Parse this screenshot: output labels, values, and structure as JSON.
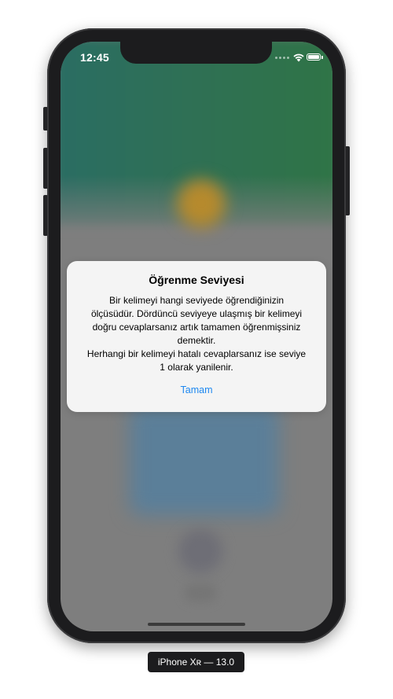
{
  "status_bar": {
    "time": "12:45",
    "icons": [
      "signal-dots-icon",
      "wifi-icon",
      "battery-icon"
    ],
    "text_color": "#ffffff"
  },
  "alert": {
    "title": "Öğrenme Seviyesi",
    "message_lines": [
      "Bir kelimeyi hangi seviyede öğrendiğinizin",
      "ölçüsüdür. Dördüncü seviyeye ulaşmış bir kelimeyi",
      "doğru cevaplarsanız artık tamamen öğrenmişsiniz",
      "demektir.",
      "Herhangi bir kelimeyi hatalı cevaplarsanız ise seviye",
      "1 olarak yanilenir."
    ],
    "button_label": "Tamam",
    "button_color": "#1e87f0",
    "background_color": "#f4f4f4"
  },
  "device": {
    "label": "iPhone Xʀ — 13.0",
    "frame_color": "#1c1c1e"
  },
  "background": {
    "top_color": "#2f7054",
    "dim_color": "#7e7e7e"
  }
}
